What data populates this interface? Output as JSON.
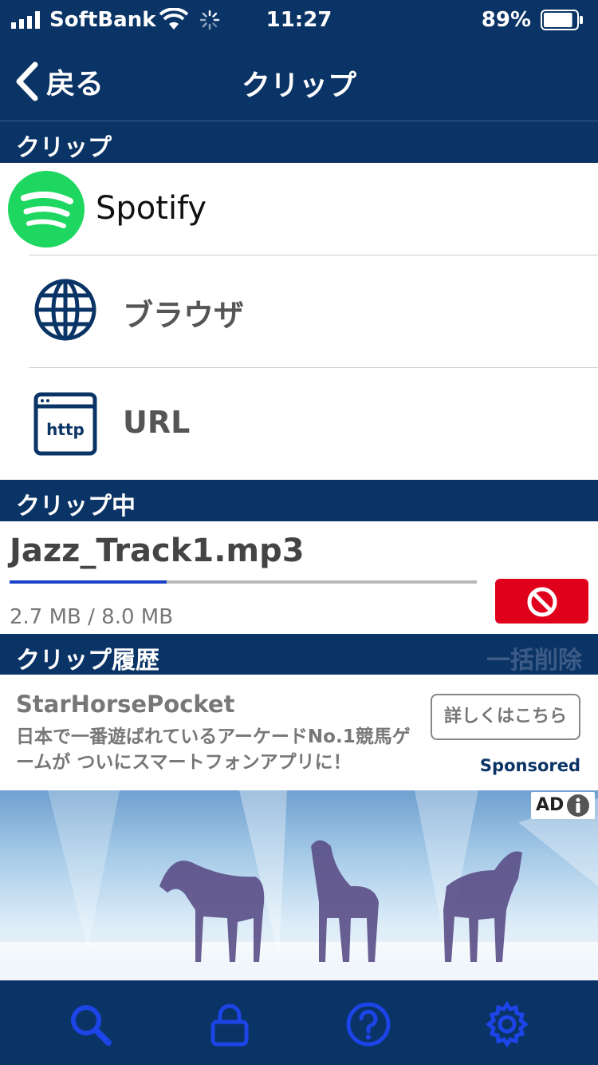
{
  "status_bar": {
    "carrier": "SoftBank",
    "time": "11:27",
    "battery_percent": "89%",
    "battery_level": 0.89
  },
  "nav": {
    "back_label": "戻る",
    "title": "クリップ"
  },
  "sections": {
    "clip": "クリップ",
    "clipping": "クリップ中",
    "history": "クリップ履歴",
    "delete_all": "一括削除"
  },
  "sources": [
    {
      "label": "Spotify",
      "icon": "spotify-logo"
    },
    {
      "label": "ブラウザ",
      "icon": "globe-icon"
    },
    {
      "label": "URL",
      "icon": "http-icon"
    }
  ],
  "current_clip": {
    "filename": "Jazz_Track1.mp3",
    "size_text": "2.7 MB / 8.0 MB",
    "progress": 0.337
  },
  "sponsored_ad": {
    "title": "StarHorsePocket",
    "description": "日本で一番遊ばれているアーケードNo.1競馬ゲームが ついにスマートフォンアプリに！",
    "cta": "詳しくはこちら",
    "sponsored_label": "Sponsored",
    "ad_badge": "AD"
  },
  "tab_bar": [
    {
      "icon": "search-icon"
    },
    {
      "icon": "lock-icon"
    },
    {
      "icon": "help-icon"
    },
    {
      "icon": "settings-icon"
    }
  ],
  "colors": {
    "navy": "#0b3466",
    "spotify_green": "#1ed760",
    "cancel_red": "#e0001b",
    "progress_blue": "#1941c8",
    "tab_icon_blue": "#1c44e6"
  }
}
